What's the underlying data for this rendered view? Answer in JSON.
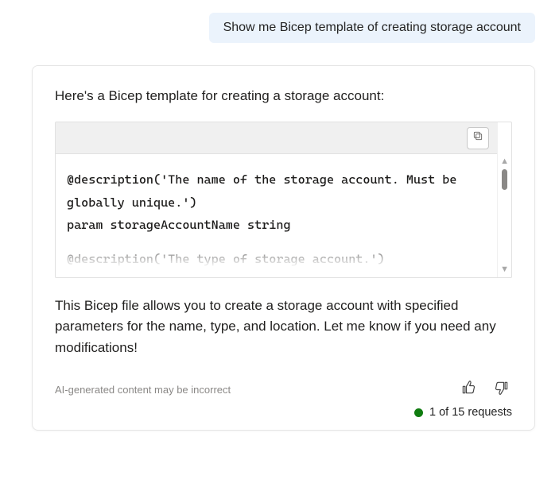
{
  "user_message": "Show me Bicep template of creating storage account",
  "assistant": {
    "intro": "Here's a Bicep template for creating a storage account:",
    "code_visible": "@description('The name of the storage account. Must be globally unique.')\nparam storageAccountName string",
    "code_peek": "@description('The type of storage account.')",
    "outro": "This Bicep file allows you to create a storage account with specified parameters for the name, type, and location. Let me know if you need any modifications!"
  },
  "footer": {
    "disclaimer": "AI-generated content may be incorrect",
    "usage_text": "1 of 15 requests",
    "dot_color": "#107c10"
  }
}
